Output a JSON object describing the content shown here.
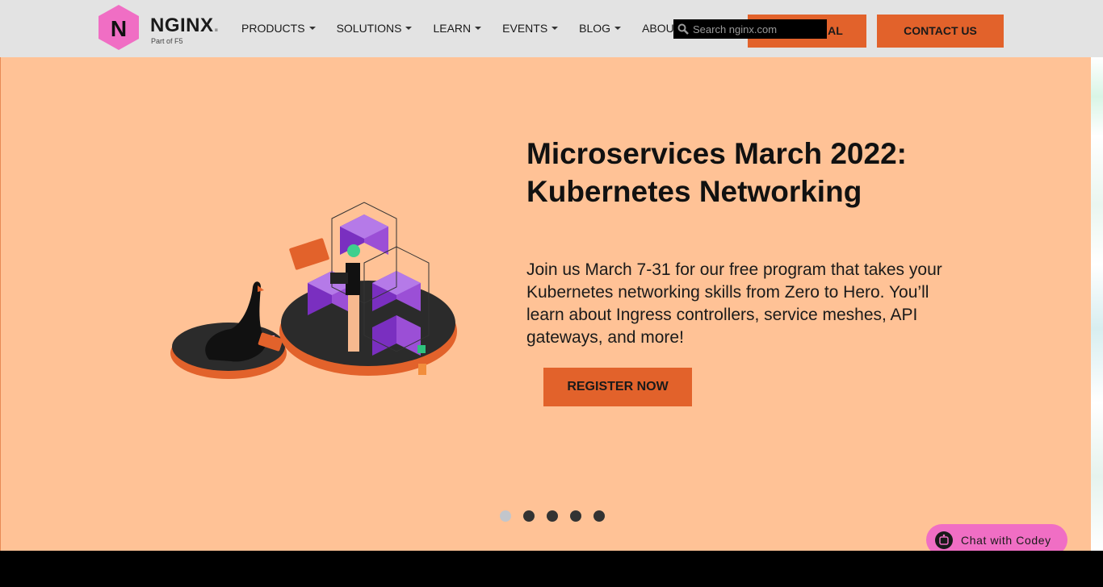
{
  "header": {
    "logo": {
      "brand": "NGINX",
      "brand_dot": ".",
      "sub": "Part of F5",
      "mark": "N"
    },
    "nav": [
      {
        "label": "PRODUCTS"
      },
      {
        "label": "SOLUTIONS"
      },
      {
        "label": "LEARN"
      },
      {
        "label": "EVENTS"
      },
      {
        "label": "BLOG"
      },
      {
        "label": "ABOUT"
      }
    ],
    "search": {
      "placeholder": "Search nginx.com"
    },
    "trial_button": "AL",
    "contact_button": "CONTACT US"
  },
  "hero": {
    "title": "Microservices March 2022: Kubernetes Networking",
    "description": "Join us March 7-31 for our free program that takes your Kubernetes networking skills from Zero to Hero. You’ll learn about Ingress controllers, service meshes, API gateways, and more!",
    "cta": "REGISTER NOW",
    "carousel": {
      "count": 5,
      "active": 0
    }
  },
  "chat": {
    "label": "Chat with Codey"
  },
  "colors": {
    "accent": "#e2622b",
    "hero_bg": "#ffc296",
    "logo_pink": "#f06ec4",
    "header_bg": "#e3e3e3"
  },
  "icons": [
    "nginx-logo-icon",
    "caret-down-icon",
    "search-icon",
    "chat-bot-icon"
  ]
}
